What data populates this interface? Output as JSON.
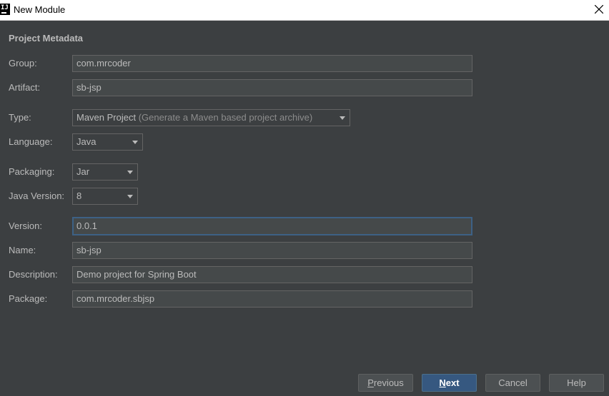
{
  "window": {
    "title": "New Module",
    "app_icon_text": "IJ"
  },
  "section_title": "Project Metadata",
  "form": {
    "group": {
      "label": "Group:",
      "value": "com.mrcoder"
    },
    "artifact": {
      "label": "Artifact:",
      "value": "sb-jsp"
    },
    "type": {
      "label": "Type:",
      "value": "Maven Project",
      "hint": "(Generate a Maven based project archive)"
    },
    "language": {
      "label": "Language:",
      "value": "Java"
    },
    "packaging": {
      "label": "Packaging:",
      "value": "Jar"
    },
    "java_version": {
      "label": "Java Version:",
      "value": "8"
    },
    "version": {
      "label": "Version:",
      "value": "0.0.1"
    },
    "name": {
      "label": "Name:",
      "value": "sb-jsp"
    },
    "description": {
      "label": "Description:",
      "value": "Demo project for Spring Boot"
    },
    "package": {
      "label": "Package:",
      "value": "com.mrcoder.sbjsp"
    }
  },
  "buttons": {
    "previous": {
      "mnemonic": "P",
      "rest": "revious"
    },
    "next": {
      "mnemonic": "N",
      "rest": "ext"
    },
    "cancel": "Cancel",
    "help": "Help"
  },
  "colors": {
    "background": "#3c3f41",
    "field_bg": "#45494a",
    "focus_border": "#3d6185",
    "primary_button": "#365880",
    "text": "#bbbbbb"
  }
}
